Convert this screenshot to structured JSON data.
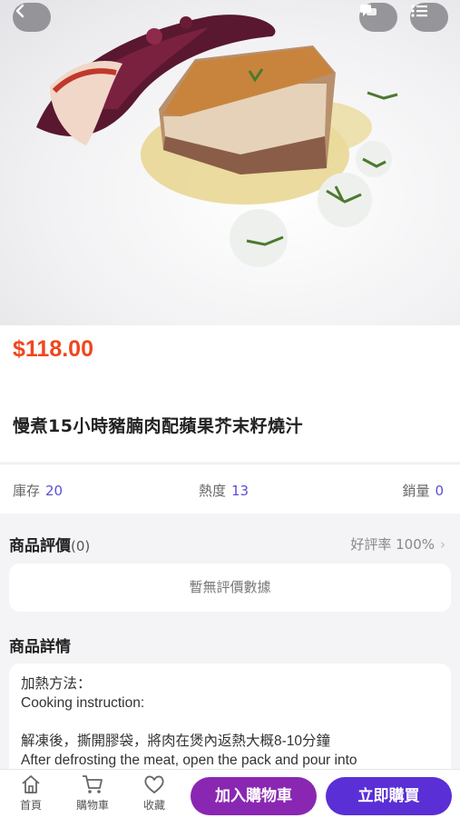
{
  "product": {
    "price": "$118.00",
    "title": "慢煮15小時豬腩肉配蘋果芥末籽燒汁"
  },
  "stats": {
    "stock_label": "庫存",
    "stock_value": "20",
    "heat_label": "熱度",
    "heat_value": "13",
    "sales_label": "銷量",
    "sales_value": "0"
  },
  "reviews": {
    "title": "商品評價",
    "count": "(0)",
    "rate_label": "好評率 100%",
    "empty_text": "暫無評價數據"
  },
  "details": {
    "title": "商品詳情",
    "lines": [
      "加熱方法：",
      "Cooking instruction:",
      "",
      "解凍後，撕開膠袋，將肉在煲內返熱大概8-10分鐘",
      "After defrosting the meat, open the pack and pour into"
    ]
  },
  "bottom_nav": {
    "home": "首頁",
    "cart": "購物車",
    "favorite": "收藏",
    "add_to_cart": "加入購物車",
    "buy_now": "立即購買"
  },
  "icons": {
    "back": "chevron-left-icon",
    "chat": "chat-icon",
    "menu": "list-menu-icon",
    "home": "home-icon",
    "cart": "cart-icon",
    "favorite": "heart-icon"
  },
  "colors": {
    "price": "#f0461e",
    "accent": "#5b4fd6",
    "add_to_cart_bg": "#8a27b2",
    "buy_now_bg": "#5a2fd6"
  }
}
